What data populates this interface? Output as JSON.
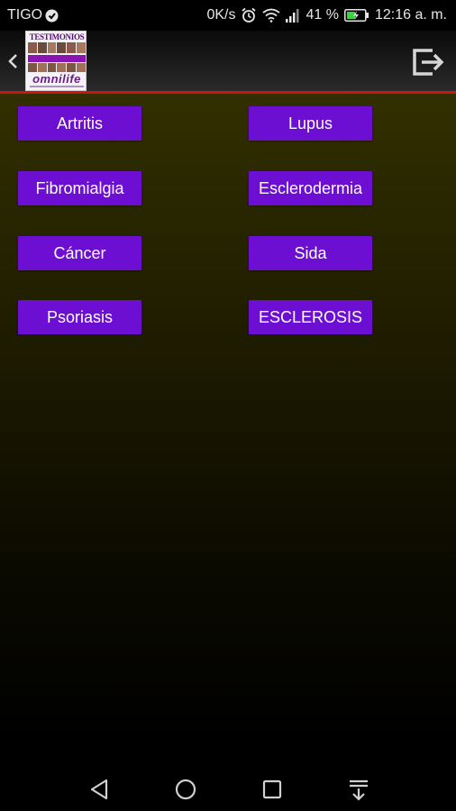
{
  "status_bar": {
    "carrier": "TIGO",
    "data_speed": "0K/s",
    "battery_percent": "41 %",
    "time": "12:16 a. m."
  },
  "toolbar": {
    "logo_title": "TESTIMONIOS",
    "logo_brand": "omnilife",
    "accent_color": "#d01414"
  },
  "buttons": {
    "col1": [
      "Artritis",
      "Fibromialgia",
      "Cáncer",
      "Psoriasis"
    ],
    "col2": [
      "Lupus",
      "Esclerodermia",
      "Sida",
      "ESCLEROSIS"
    ]
  },
  "colors": {
    "button_bg": "#6d0fd2",
    "content_bg_top": "#322f00"
  }
}
